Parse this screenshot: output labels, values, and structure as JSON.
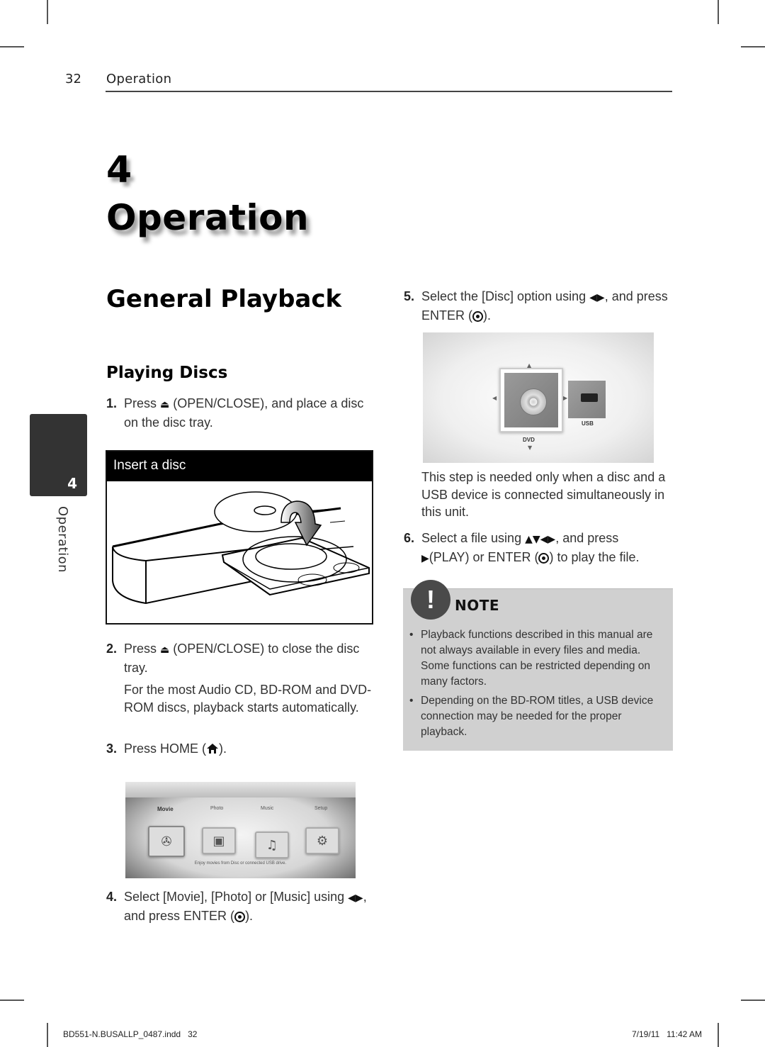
{
  "header": {
    "page_number": "32",
    "section": "Operation"
  },
  "chapter": {
    "number": "4",
    "title": "Operation"
  },
  "side_tab": {
    "number": "4",
    "label": "Operation"
  },
  "section_title": "General Playback",
  "subsection_title": "Playing Discs",
  "steps": [
    {
      "num": "1.",
      "pre": "Press",
      "icon": "eject",
      "post": "(OPEN/CLOSE), and place a disc on the disc tray."
    },
    {
      "num": "2.",
      "pre": "Press",
      "icon": "eject",
      "post": "(OPEN/CLOSE) to close the disc tray.",
      "extra": "For the most Audio CD, BD-ROM and DVD-ROM discs, playback starts automatically."
    },
    {
      "num": "3.",
      "pre": "Press HOME (",
      "icon": "home",
      "post": ")."
    },
    {
      "num": "4.",
      "pre": "Select [Movie], [Photo] or [Music] using",
      "arrows": "◀▶",
      "mid": ", and press ENTER (",
      "post": ")."
    },
    {
      "num": "5.",
      "pre": "Select the [Disc] option using",
      "arrows": "◀▶",
      "mid": ", and press ENTER (",
      "post": ").",
      "extra": "This step is needed only when a disc and a USB device is connected simultaneously in this unit."
    },
    {
      "num": "6.",
      "pre": "Select a file using",
      "arrows": "▲▼◀▶",
      "mid": ", and press",
      "play": "▶",
      "mid2": "(PLAY) or ENTER (",
      "post": ") to play the file."
    }
  ],
  "figure_insert_disc": {
    "caption": "Insert a disc"
  },
  "home_menu": {
    "items": [
      "Movie",
      "Photo",
      "Music",
      "Setup"
    ],
    "active": "Movie",
    "caption": "Enjoy movies from Disc or connected USB drive."
  },
  "disc_select": {
    "options": [
      "DVD",
      "USB"
    ],
    "selected": "DVD"
  },
  "note": {
    "title": "NOTE",
    "icon": "!",
    "items": [
      "Playback functions described in this manual are not always available in every files and media. Some functions can be restricted depending on many factors.",
      "Depending on the BD-ROM titles, a USB device connection may be needed for the proper playback."
    ]
  },
  "footer": {
    "file": "BD551-N.BUSALLP_0487.indd   32",
    "timestamp": "7/19/11   11:42 AM"
  }
}
